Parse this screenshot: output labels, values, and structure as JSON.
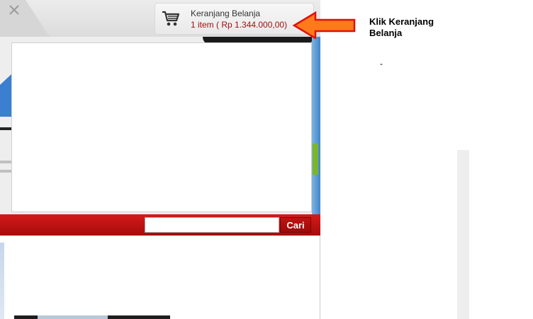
{
  "cart": {
    "title": "Keranjang Belanja",
    "summary": "1 item ( Rp 1.344.000,00)",
    "icon": "shopping-cart-icon"
  },
  "search": {
    "placeholder": "",
    "value": "",
    "button_label": "Cari"
  },
  "annotation": {
    "text": "Klik Keranjang Belanja",
    "dash": "-",
    "arrow_color": "#ff7a1a",
    "arrow_outline": "#e01010"
  },
  "colors": {
    "brand_red": "#c21212",
    "accent_blue": "#3f86c9",
    "accent_green": "#7bb52b"
  }
}
